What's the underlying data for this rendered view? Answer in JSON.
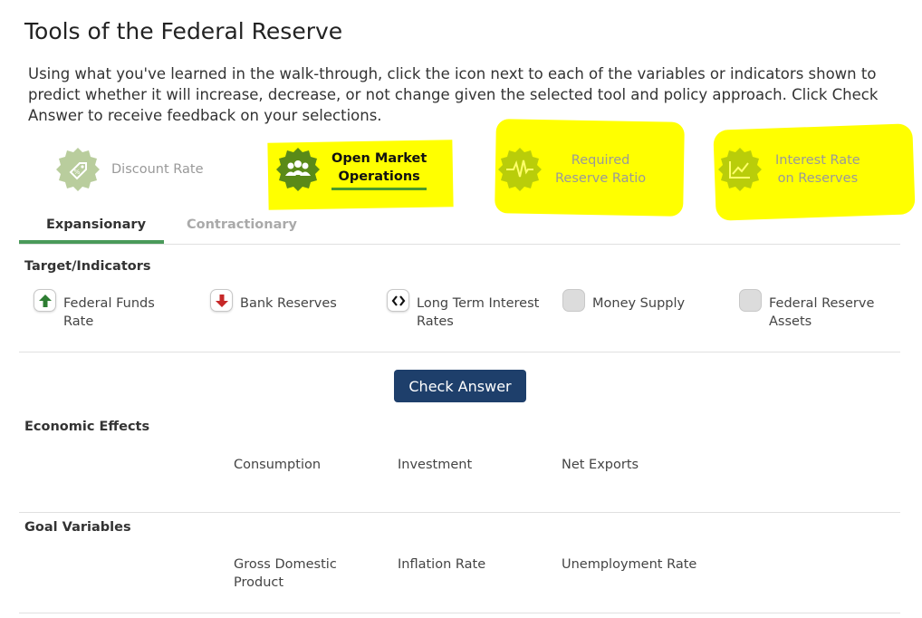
{
  "page": {
    "title": "Tools of the Federal Reserve",
    "intro": "Using what you've learned in the walk-through, click the icon next to each of the variables or indicators shown to predict whether it will increase, decrease, or not change given the selected tool and policy approach. Click Check Answer to receive feedback on your selections."
  },
  "tools": [
    {
      "label": "Discount Rate",
      "icon": "tag-percent-icon",
      "state": "inactive",
      "highlighted": false
    },
    {
      "label_line1": "Open Market",
      "label_line2": "Operations",
      "icon": "people-group-icon",
      "state": "active",
      "highlighted": true
    },
    {
      "label_line1": "Required",
      "label_line2": "Reserve Ratio",
      "icon": "heartbeat-pulse-icon",
      "state": "inactive",
      "highlighted": true
    },
    {
      "label_line1": "Interest Rate",
      "label_line2": "on Reserves",
      "icon": "line-chart-icon",
      "state": "inactive",
      "highlighted": true
    }
  ],
  "tabs": {
    "expansionary": "Expansionary",
    "contractionary": "Contractionary",
    "selected": "Expansionary"
  },
  "indicators": {
    "heading": "Target/Indicators",
    "items": [
      {
        "line1": "Federal Funds",
        "line2": "Rate",
        "prediction": "increase",
        "icon": "arrow-up-icon"
      },
      {
        "line1": "Bank Reserves",
        "prediction": "decrease",
        "icon": "arrow-down-icon"
      },
      {
        "line1": "Long Term Interest",
        "line2": "Rates",
        "prediction": "no change",
        "icon": "left-right-arrows-icon"
      },
      {
        "line1": "Money Supply",
        "prediction": "unselected",
        "icon": "blank-square-icon"
      },
      {
        "line1": "Federal Reserve",
        "line2": "Assets",
        "prediction": "unselected",
        "icon": "blank-square-icon"
      }
    ]
  },
  "check_button": "Check Answer",
  "economic_effects": {
    "heading": "Economic Effects",
    "items": [
      "Consumption",
      "Investment",
      "Net Exports"
    ]
  },
  "goal_variables": {
    "heading": "Goal Variables",
    "items": [
      {
        "line1": "Gross Domestic",
        "line2": "Product"
      },
      {
        "line1": "Inflation Rate"
      },
      {
        "line1": "Unemployment Rate"
      }
    ]
  },
  "colors": {
    "badge_green": "#5a8a18",
    "active_underline": "#4a9a2a",
    "tab_underline": "#4a9a5a",
    "button": "#1e3f6b",
    "arrow_up": "#2e7d32",
    "arrow_down": "#c62828",
    "highlight": "#ffff00"
  }
}
